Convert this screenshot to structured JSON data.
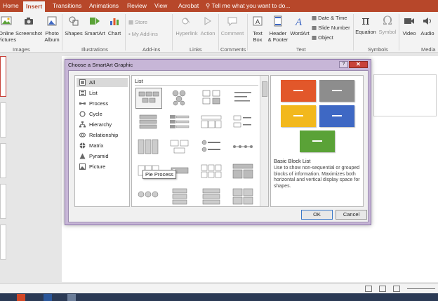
{
  "tabs": [
    {
      "label": "Home"
    },
    {
      "label": "Insert"
    },
    {
      "label": "Transitions"
    },
    {
      "label": "Animations"
    },
    {
      "label": "Review"
    },
    {
      "label": "View"
    },
    {
      "label": "Acrobat"
    }
  ],
  "tell_me": "Tell me what you want to do...",
  "ribbon": {
    "images": {
      "online_pictures": "Online\nPictures",
      "screenshot": "Screenshot",
      "photo_album": "Photo\nAlbum",
      "group": "Images"
    },
    "illustrations": {
      "shapes": "Shapes",
      "smartart": "SmartArt",
      "chart": "Chart",
      "group": "Illustrations"
    },
    "addins": {
      "store": "Store",
      "my_addins": "My Add-ins",
      "group": "Add-ins"
    },
    "links": {
      "hyperlink": "Hyperlink",
      "action": "Action",
      "group": "Links"
    },
    "comments": {
      "comment": "Comment",
      "group": "Comments"
    },
    "text": {
      "text_box": "Text\nBox",
      "header_footer": "Header\n& Footer",
      "wordart": "WordArt",
      "date_time": "Date & Time",
      "slide_number": "Slide Number",
      "object": "Object",
      "group": "Text"
    },
    "symbols": {
      "equation": "Equation",
      "symbol": "Symbol",
      "group": "Symbols"
    },
    "media": {
      "video": "Video",
      "audio": "Audio",
      "group": "Media"
    }
  },
  "dialog": {
    "title": "Choose a SmartArt Graphic",
    "help": "?",
    "close": "✕",
    "categories": [
      {
        "label": "All",
        "icon": "all-icon"
      },
      {
        "label": "List",
        "icon": "list-icon"
      },
      {
        "label": "Process",
        "icon": "process-icon"
      },
      {
        "label": "Cycle",
        "icon": "cycle-icon"
      },
      {
        "label": "Hierarchy",
        "icon": "hierarchy-icon"
      },
      {
        "label": "Relationship",
        "icon": "relationship-icon"
      },
      {
        "label": "Matrix",
        "icon": "matrix-icon"
      },
      {
        "label": "Pyramid",
        "icon": "pyramid-icon"
      },
      {
        "label": "Picture",
        "icon": "picture-icon"
      }
    ],
    "gallery_header": "List",
    "tooltip": "Pie Process",
    "preview_title": "Basic Block List",
    "preview_description": "Use to show non-sequential or grouped blocks of information. Maximizes both horizontal and vertical display space for shapes.",
    "ok": "OK",
    "cancel": "Cancel",
    "preview_colors": [
      "#e2572a",
      "#8d8d8d",
      "#f2b81d",
      "#3e68c4",
      "#5aa237"
    ]
  }
}
